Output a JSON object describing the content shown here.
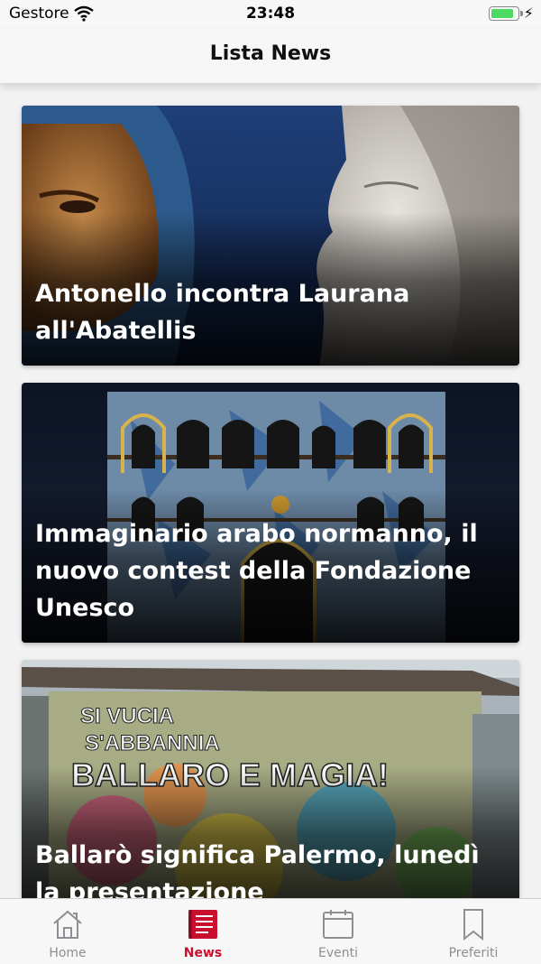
{
  "status_bar": {
    "carrier": "Gestore",
    "time": "23:48",
    "battery_level": 0.85
  },
  "nav": {
    "title": "Lista News"
  },
  "news": [
    {
      "title": "Antonello incontra Laurana all'Abatellis"
    },
    {
      "title": "Immaginario arabo normanno, il nuovo contest della Fondazione Unesco"
    },
    {
      "title": "Ballarò significa Palermo, lunedì la presentazione"
    }
  ],
  "card3_graffiti": [
    "SI VUCIA",
    "S'ABBANNIA",
    "BALLARO E MAGIA!"
  ],
  "tabs": [
    {
      "label": "Home",
      "icon": "house-icon",
      "active": false
    },
    {
      "label": "News",
      "icon": "news-icon",
      "active": true
    },
    {
      "label": "Eventi",
      "icon": "calendar-icon",
      "active": false
    },
    {
      "label": "Preferiti",
      "icon": "bookmark-icon",
      "active": false
    }
  ],
  "colors": {
    "accent": "#c8102e",
    "inactive": "#8e8e93"
  }
}
